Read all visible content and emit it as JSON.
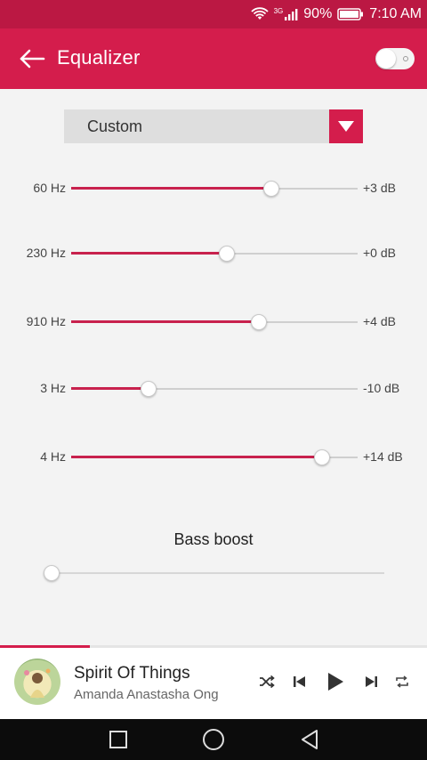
{
  "status_bar": {
    "network": "3G",
    "battery": "90%",
    "time": "7:10 AM"
  },
  "app_bar": {
    "title": "Equalizer",
    "back_icon": "arrow-left-icon",
    "toggle_on": false
  },
  "preset": {
    "selected": "Custom"
  },
  "bands": [
    {
      "label": "60 Hz",
      "value": "+3 dB",
      "level": 0.7
    },
    {
      "label": "230 Hz",
      "value": "+0 dB",
      "level": 0.545
    },
    {
      "label": "910 Hz",
      "value": "+4 dB",
      "level": 0.655
    },
    {
      "label": "3 Hz",
      "value": "-10 dB",
      "level": 0.27
    },
    {
      "label": "4 Hz",
      "value": "+14 dB",
      "level": 0.875
    }
  ],
  "bass_boost": {
    "title": "Bass boost",
    "level": 0.0
  },
  "now_playing": {
    "title": "Spirit Of Things",
    "artist": "Amanda Anastasha Ong",
    "progress": 0.21
  },
  "colors": {
    "accent": "#d41d4c",
    "status_bar": "#bb1843"
  }
}
